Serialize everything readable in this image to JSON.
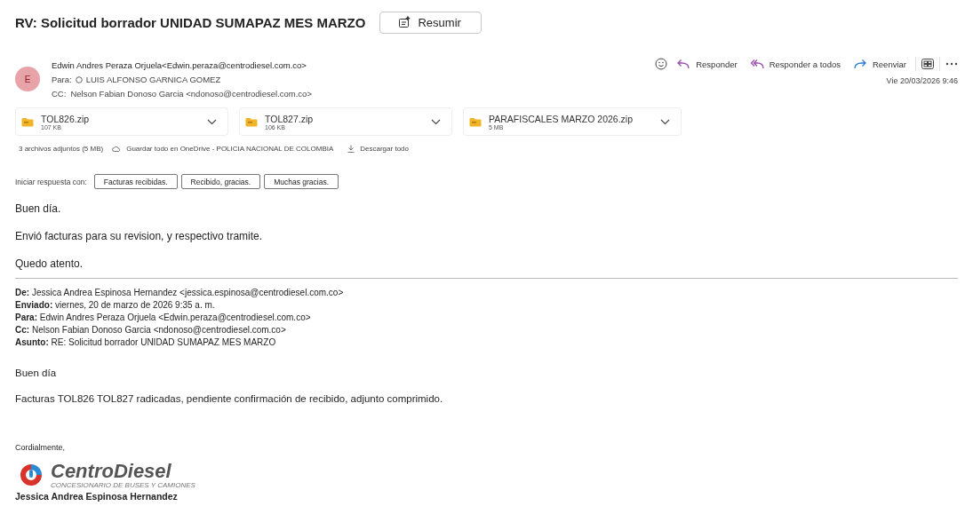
{
  "subject": "RV: Solicitud borrador UNIDAD SUMAPAZ MES MARZO",
  "summarize_button": "Resumir",
  "sender": {
    "initial": "E",
    "name": "Edwin Andres Peraza Orjuela",
    "address": "<Edwin.peraza@centrodiesel.com.co>"
  },
  "to": {
    "label": "Para:",
    "name": "LUIS ALFONSO GARNICA GOMEZ"
  },
  "cc": {
    "label": "CC:",
    "value": "Nelson Fabian Donoso Garcia <ndonoso@centrodiesel.com.co>"
  },
  "actions": [
    {
      "kind": "reply",
      "label": "Responder"
    },
    {
      "kind": "reply_all",
      "label": "Responder a todos"
    },
    {
      "kind": "forward",
      "label": "Reenviar"
    }
  ],
  "date": "Vie 20/03/2026 9:46",
  "attachments": [
    {
      "name": "TOL826.zip",
      "size": "107 KB"
    },
    {
      "name": "TOL827.zip",
      "size": "106 KB"
    },
    {
      "name": "PARAFISCALES MARZO 2026.zip",
      "size": "5 MB"
    }
  ],
  "attachment_summary": "3 archivos adjuntos (5 MB)",
  "save_all": "Guardar todo en OneDrive - POLICIA NACIONAL DE COLOMBIA",
  "download_all": "Descargar todo",
  "quick_reply": {
    "label": "Iniciar respuesta con:",
    "options": [
      "Facturas recibidas.",
      "Recibido, gracias.",
      "Muchas gracias."
    ]
  },
  "body": [
    "Buen día.",
    "Envió facturas para su revision, y respectivo tramite.",
    "Quedo atento."
  ],
  "quoted_header": [
    {
      "label": "De:",
      "value": "Jessica Andrea Espinosa Hernandez <jessica.espinosa@centrodiesel.com.co>"
    },
    {
      "label": "Enviado:",
      "value": "viernes, 20 de marzo de 2026 9:35 a. m."
    },
    {
      "label": "Para:",
      "value": "Edwin Andres Peraza Orjuela <Edwin.peraza@centrodiesel.com.co>"
    },
    {
      "label": "Cc:",
      "value": "Nelson Fabian Donoso Garcia <ndonoso@centrodiesel.com.co>"
    },
    {
      "label": "Asunto:",
      "value": "RE: Solicitud borrador UNIDAD SUMAPAZ MES MARZO"
    }
  ],
  "quoted_body": [
    "Buen día",
    "Facturas TOL826 TOL827 radicadas, pendiente confirmación de recibido, adjunto comprimido."
  ],
  "signature": {
    "closing": "Cordialmente,",
    "logo_name": "CentroDiesel",
    "logo_tagline": "CONCESIONARIO DE BUSES Y CAMIONES",
    "name": "Jessica Andrea Espinosa Hernandez"
  }
}
